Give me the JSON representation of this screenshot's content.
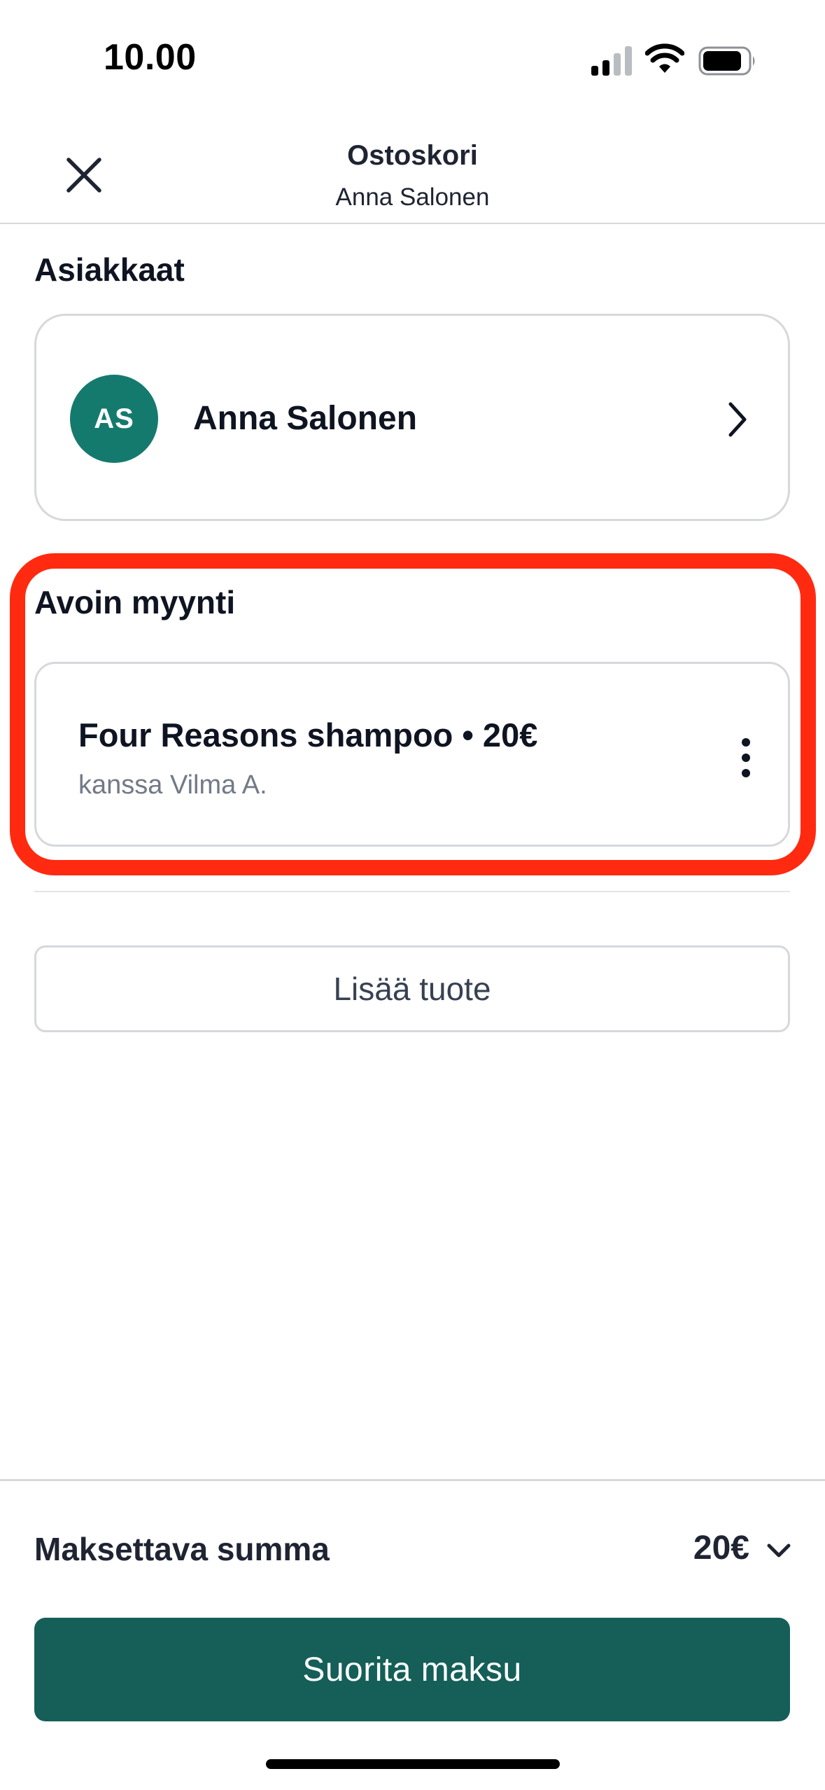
{
  "status_bar": {
    "time": "10.00"
  },
  "header": {
    "title": "Ostoskori",
    "subtitle": "Anna Salonen"
  },
  "customers": {
    "section_title": "Asiakkaat",
    "customer": {
      "initials": "AS",
      "name": "Anna Salonen"
    }
  },
  "open_sale": {
    "section_title": "Avoin myynti",
    "item": {
      "title": "Four Reasons shampoo • 20€",
      "subtitle": "kanssa Vilma A."
    }
  },
  "add_product": {
    "label": "Lisää tuote"
  },
  "footer": {
    "total_label": "Maksettava summa",
    "total_value": "20€",
    "pay_label": "Suorita maksu"
  },
  "colors": {
    "accent": "#155f58",
    "avatar": "#157a6e",
    "highlight": "#ff2a10"
  },
  "icons": {
    "close": "close-icon",
    "chevron_right": "chevron-right-icon",
    "more": "more-vertical-icon",
    "chevron_down": "chevron-down-icon"
  }
}
